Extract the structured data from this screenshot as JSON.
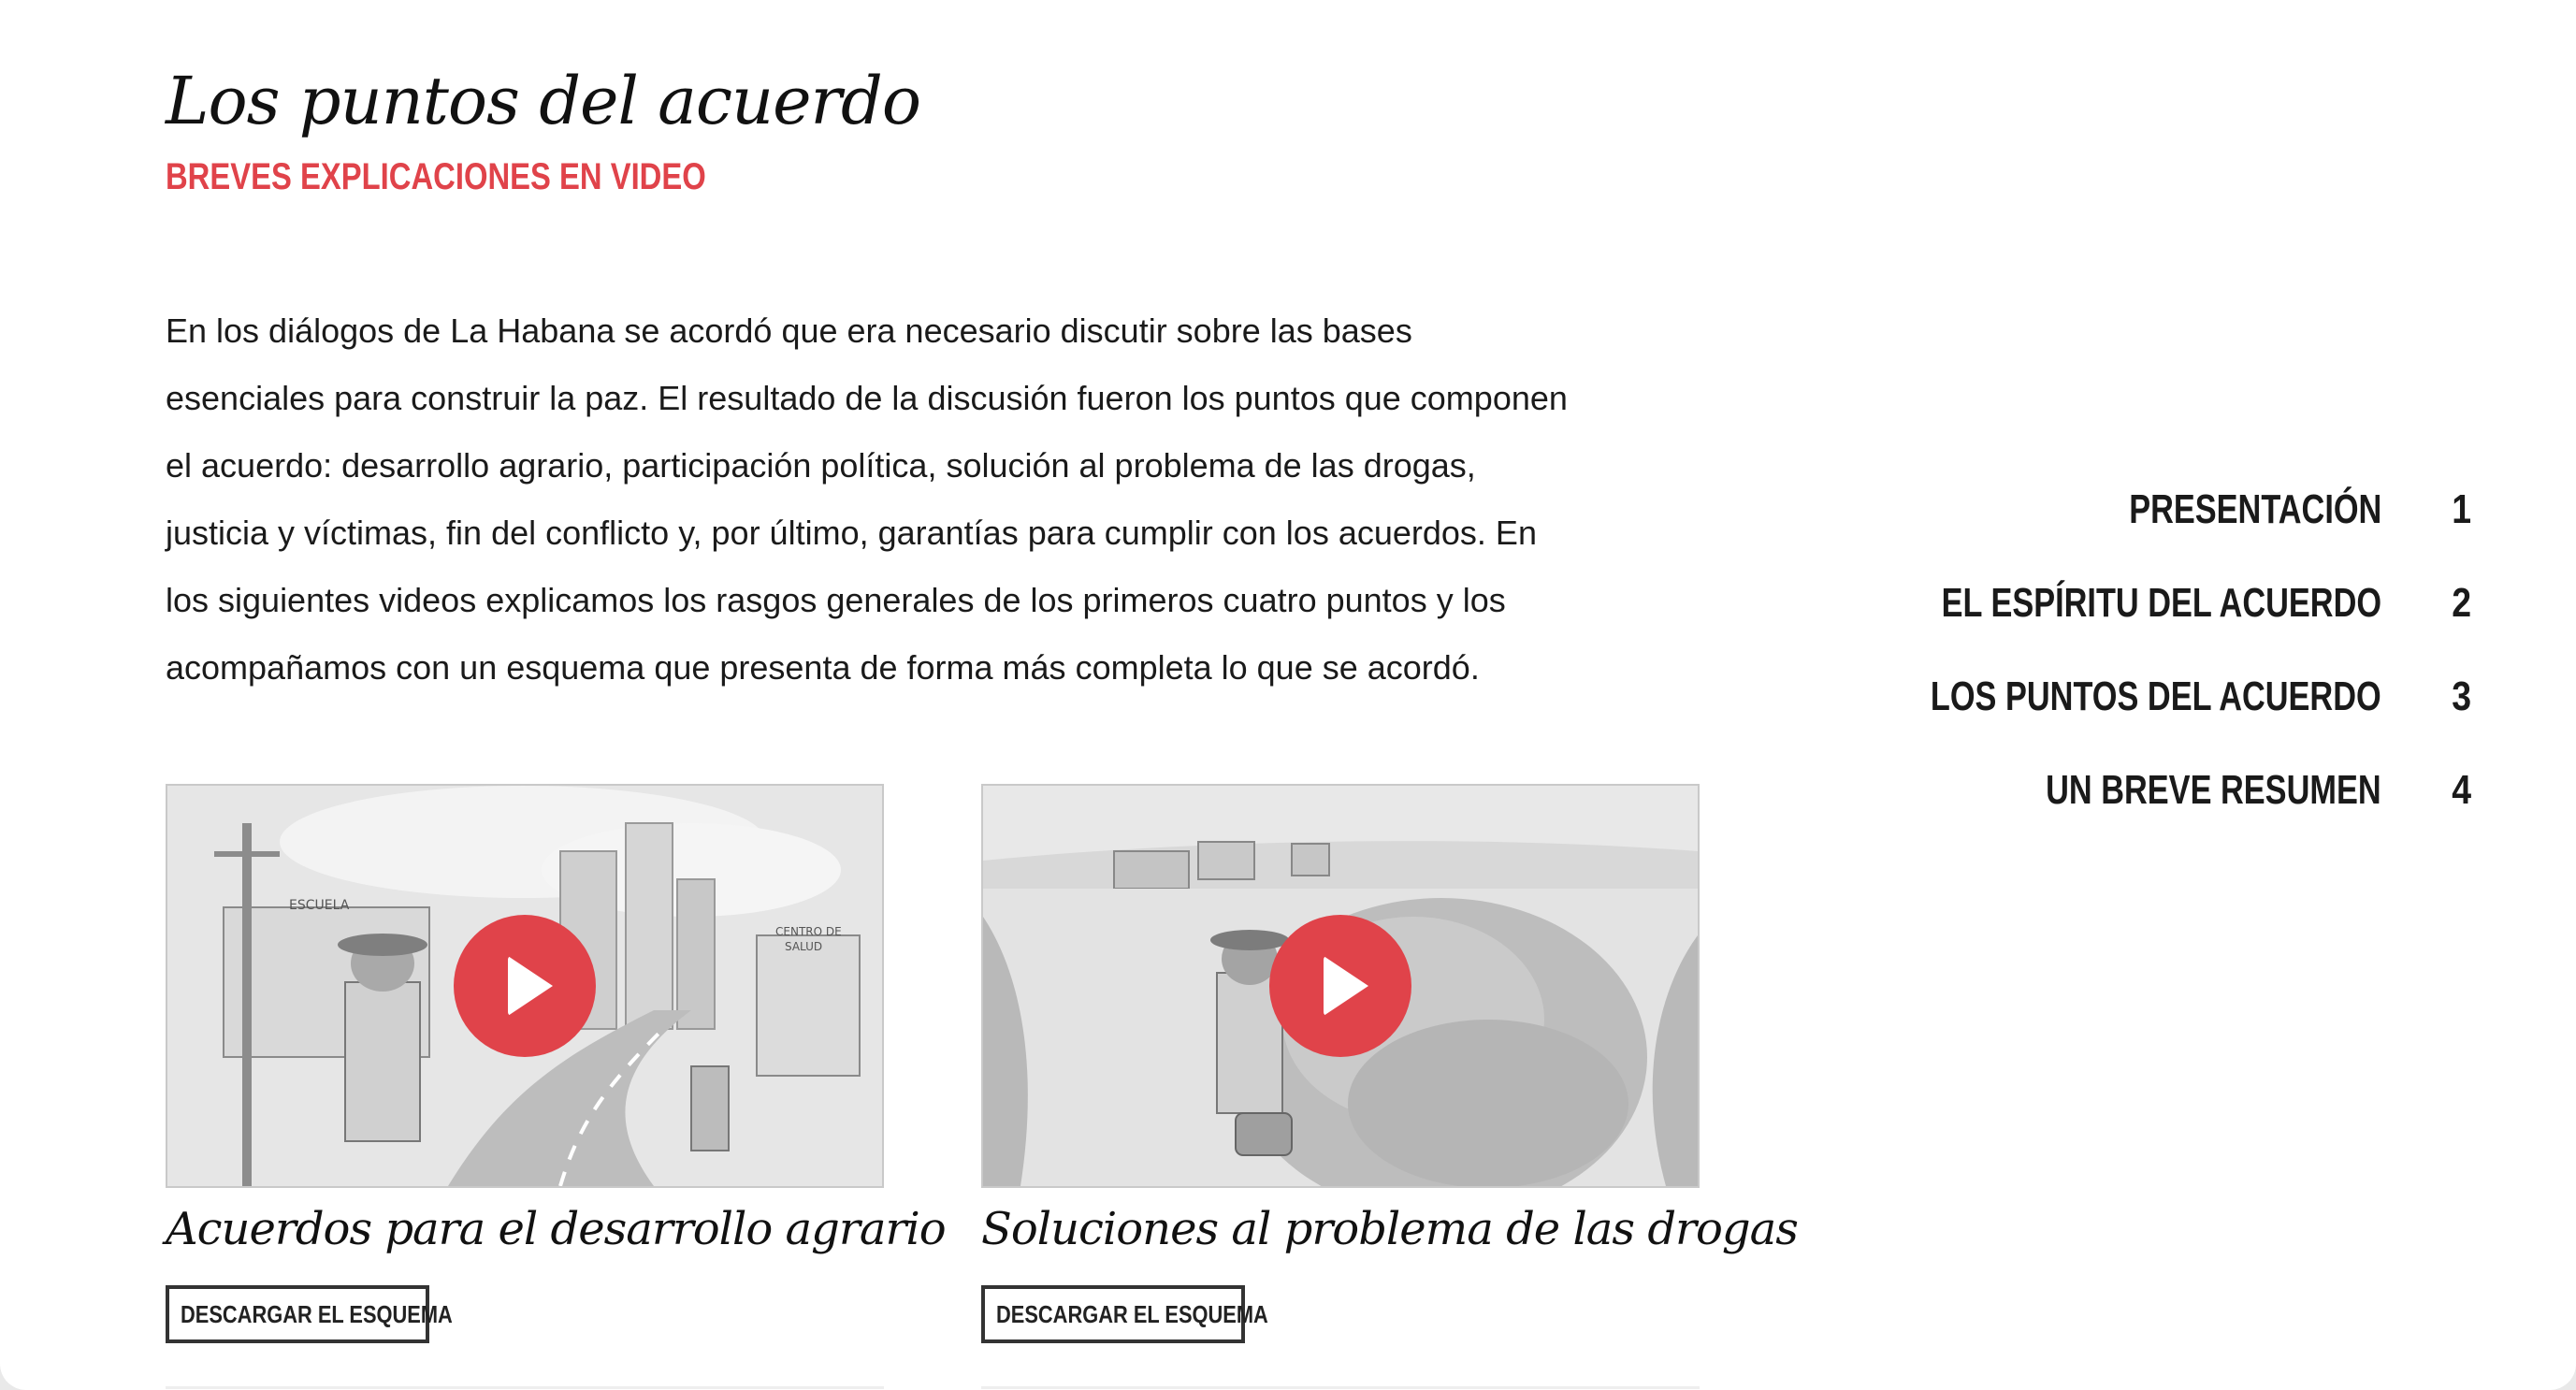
{
  "header": {
    "title": "Los puntos del acuerdo",
    "subtitle": "BREVES EXPLICACIONES EN VIDEO"
  },
  "intro": {
    "lines": [
      "En los diálogos de La Habana se acordó que era necesario discutir sobre las bases",
      "esenciales para construir la paz. El resultado de la discusión fueron los puntos que componen",
      "el acuerdo: desarrollo agrario, participación política, solución al problema de las drogas,",
      "justicia y víctimas, fin del conflicto y, por último, garantías para cumplir con los acuerdos. En",
      "los siguientes videos explicamos los rasgos generales de los primeros cuatro puntos y los",
      "acompañamos con un esquema que presenta de forma más completa lo que se acordó."
    ]
  },
  "cards": [
    {
      "title": "Acuerdos para el desarrollo agrario",
      "button_label": "DESCARGAR EL ESQUEMA",
      "illustration_labels": [
        "ESCUELA",
        "CENTRO DE",
        "SALUD"
      ]
    },
    {
      "title": "Soluciones al problema de las drogas",
      "button_label": "DESCARGAR EL ESQUEMA"
    }
  ],
  "colors": {
    "accent": "#e0434a",
    "text": "#1a1a1a"
  },
  "toc": {
    "items": [
      {
        "label": "PRESENTACIÓN",
        "number": "1"
      },
      {
        "label": "EL ESPÍRITU DEL ACUERDO",
        "number": "2"
      },
      {
        "label": "LOS PUNTOS DEL ACUERDO",
        "number": "3"
      },
      {
        "label": "UN BREVE RESUMEN",
        "number": "4"
      }
    ]
  }
}
